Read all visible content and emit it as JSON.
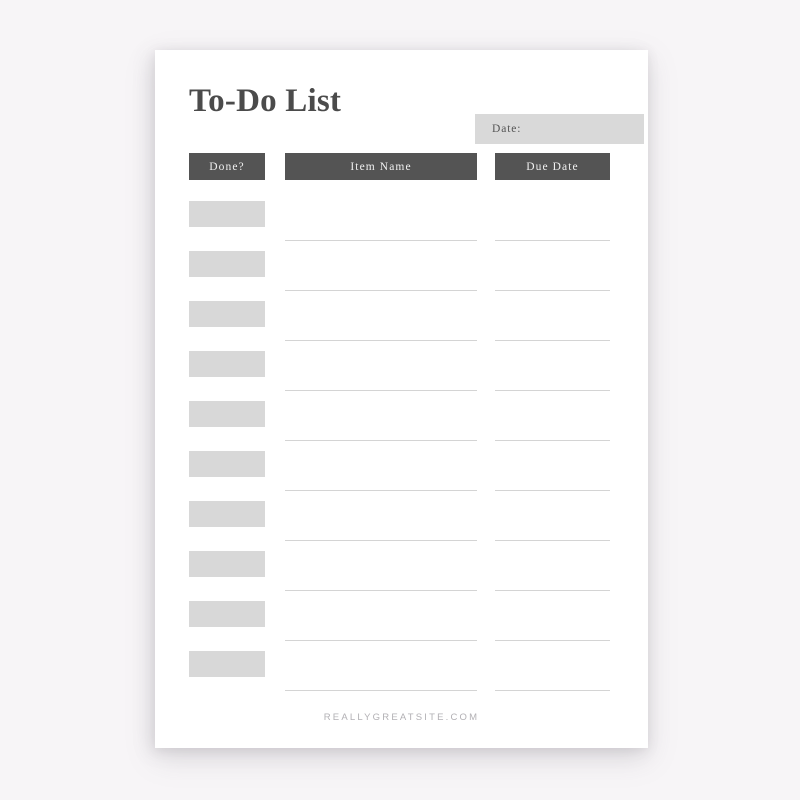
{
  "page": {
    "background_color": "#f7f5f7",
    "sheet_color": "#ffffff"
  },
  "header": {
    "title": "To-Do List",
    "date_field": {
      "label": "Date:",
      "value": "",
      "placeholder": "",
      "background_color": "#d9d9d9"
    }
  },
  "table": {
    "header_bar_color": "#545454",
    "header_text_color": "#f0f0f0",
    "checkbox_color": "#d8d8d8",
    "rule_color": "#d4d4d4",
    "columns": [
      {
        "key": "done",
        "label": "Done?"
      },
      {
        "key": "item",
        "label": "Item Name"
      },
      {
        "key": "due",
        "label": "Due Date"
      }
    ],
    "rows": [
      {
        "done": "",
        "item": "",
        "due": ""
      },
      {
        "done": "",
        "item": "",
        "due": ""
      },
      {
        "done": "",
        "item": "",
        "due": ""
      },
      {
        "done": "",
        "item": "",
        "due": ""
      },
      {
        "done": "",
        "item": "",
        "due": ""
      },
      {
        "done": "",
        "item": "",
        "due": ""
      },
      {
        "done": "",
        "item": "",
        "due": ""
      },
      {
        "done": "",
        "item": "",
        "due": ""
      },
      {
        "done": "",
        "item": "",
        "due": ""
      },
      {
        "done": "",
        "item": "",
        "due": ""
      }
    ],
    "row_count": 10
  },
  "footer": {
    "website": "REALLYGREATSITE.COM"
  }
}
